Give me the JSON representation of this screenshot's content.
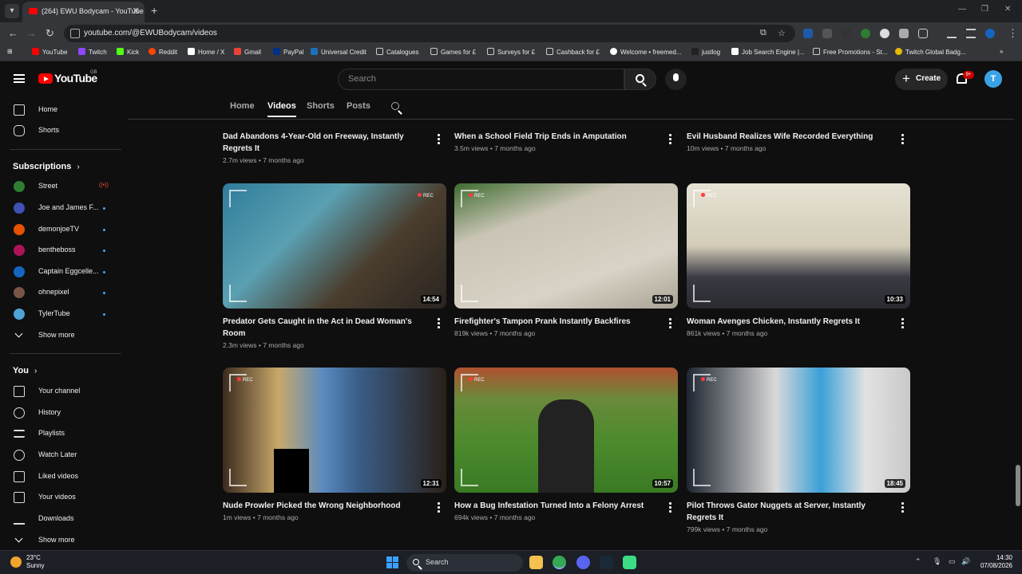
{
  "browser": {
    "tab_title": "(264) EWU Bodycam - YouTube",
    "url": "youtube.com/@EWUBodycam/videos",
    "bookmarks": [
      "YouTube",
      "Twitch",
      "Kick",
      "Reddit",
      "Home / X",
      "Gmail",
      "PayPal",
      "Universal Credit",
      "Catalogues",
      "Games for £",
      "Surveys for £",
      "Cashback for £",
      "Welcome • freemed...",
      "justlog",
      "Job Search Engine |...",
      "Free Promotions - St...",
      "Twitch Global Badg..."
    ]
  },
  "header": {
    "logo_text": "YouTube",
    "country_code": "GB",
    "search_placeholder": "Search",
    "create_label": "Create",
    "notification_badge": "9+",
    "avatar_letter": "T"
  },
  "sidebar": {
    "main": [
      {
        "label": "Home",
        "icon": "home-icon"
      },
      {
        "label": "Shorts",
        "icon": "shorts-icon"
      }
    ],
    "subscriptions_title": "Subscriptions",
    "subscriptions": [
      {
        "label": "Street",
        "color": "#2e7d32",
        "status": "live"
      },
      {
        "label": "Joe and James F...",
        "color": "#3f51b5",
        "status": "new"
      },
      {
        "label": "demonjoeTV",
        "color": "#e65100",
        "status": "new"
      },
      {
        "label": "bentheboss",
        "color": "#ad1457",
        "status": "new"
      },
      {
        "label": "Captain Eggcelle...",
        "color": "#1565c0",
        "status": "new"
      },
      {
        "label": "ohnepixel",
        "color": "#795548",
        "status": "new"
      },
      {
        "label": "TylerTube",
        "color": "#4fa3d8",
        "status": "new"
      }
    ],
    "show_more_1": "Show more",
    "you_title": "You",
    "you_items": [
      {
        "label": "Your channel",
        "icon": "channel-icon"
      },
      {
        "label": "History",
        "icon": "history-icon"
      },
      {
        "label": "Playlists",
        "icon": "playlists-icon"
      },
      {
        "label": "Watch Later",
        "icon": "clock-icon"
      },
      {
        "label": "Liked videos",
        "icon": "thumbs-up-icon"
      },
      {
        "label": "Your videos",
        "icon": "video-icon"
      },
      {
        "label": "Downloads",
        "icon": "download-icon"
      }
    ],
    "show_more_2": "Show more"
  },
  "channel_tabs": [
    "Home",
    "Videos",
    "Shorts",
    "Posts"
  ],
  "active_tab": "Videos",
  "videos": [
    {
      "title": "Dad Abandons 4-Year-Old on Freeway, Instantly Regrets It",
      "views": "2.7m views",
      "age": "7 months ago",
      "duration": "",
      "bg": "#4a5a3a"
    },
    {
      "title": "When a School Field Trip Ends in Amputation",
      "views": "3.5m views",
      "age": "7 months ago",
      "duration": "",
      "bg": "#5b3a4a"
    },
    {
      "title": "Evil Husband Realizes Wife Recorded Everything",
      "views": "10m views",
      "age": "7 months ago",
      "duration": "",
      "bg": "#6a6a6a"
    },
    {
      "title": "Predator Gets Caught in the Act in Dead Woman's Room",
      "views": "2.3m views",
      "age": "7 months ago",
      "duration": "14:54",
      "bg": "#3e7a8a",
      "rec": true
    },
    {
      "title": "Firefighter's Tampon Prank Instantly Backfires",
      "views": "819k views",
      "age": "7 months ago",
      "duration": "12:01",
      "bg": "#9a9a8a",
      "rec": true
    },
    {
      "title": "Woman Avenges Chicken, Instantly Regrets It",
      "views": "861k views",
      "age": "7 months ago",
      "duration": "10:33",
      "bg": "#b8b29a",
      "rec": true
    },
    {
      "title": "Nude Prowler Picked the Wrong Neighborhood",
      "views": "1m views",
      "age": "7 months ago",
      "duration": "12:31",
      "bg": "#6b4a2a",
      "rec": true
    },
    {
      "title": "How a Bug Infestation Turned Into a Felony Arrest",
      "views": "694k views",
      "age": "7 months ago",
      "duration": "10:57",
      "bg": "#3f7a30",
      "rec": true
    },
    {
      "title": "Pilot Throws Gator Nuggets at Server, Instantly Regrets It",
      "views": "799k views",
      "age": "7 months ago",
      "duration": "18:45",
      "bg": "#5a6a7a",
      "rec": true
    }
  ],
  "taskbar": {
    "temp": "23°C",
    "condition": "Sunny",
    "search_label": "Search",
    "time": "14:30",
    "date": "07/08/2026"
  }
}
